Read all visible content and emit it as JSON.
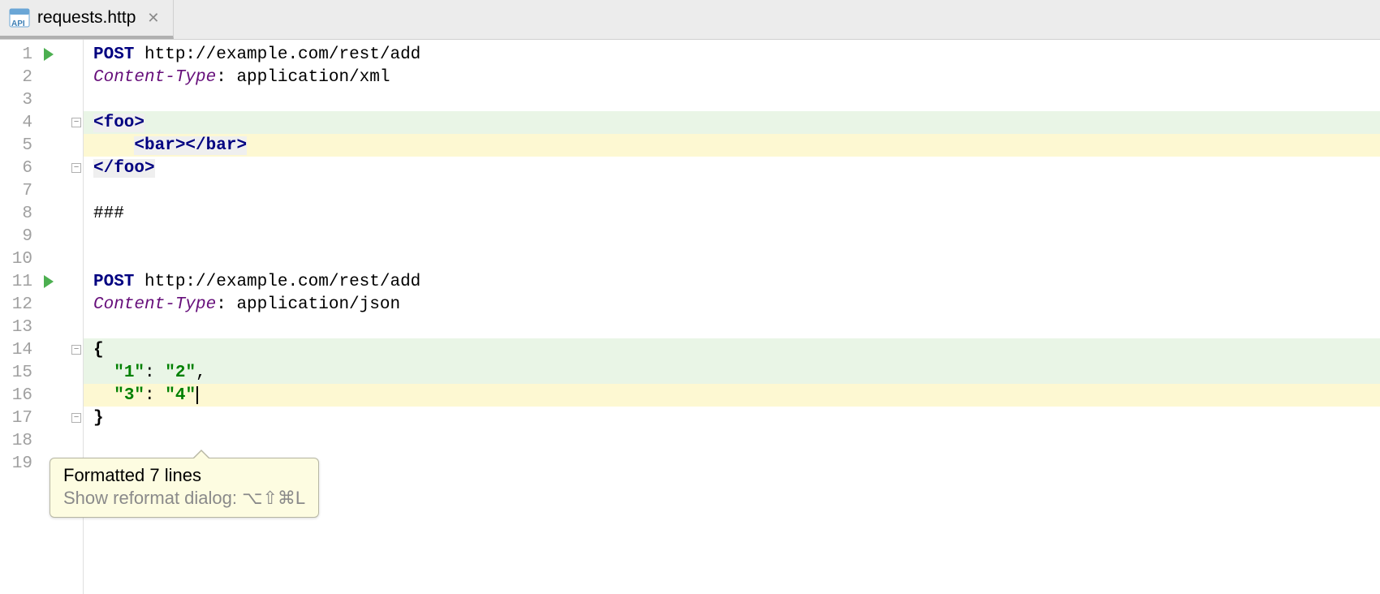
{
  "tab": {
    "filename": "requests.http",
    "icon_label": "API"
  },
  "gutter": {
    "line_count": 19,
    "run_markers": [
      1,
      11
    ],
    "fold_open": [
      4,
      14
    ],
    "fold_close": [
      6,
      17
    ]
  },
  "code": {
    "lines": [
      {
        "n": 1,
        "seg": [
          {
            "c": "kw",
            "t": "POST"
          },
          {
            "c": "txt",
            "t": " http://example.com/rest/add"
          }
        ]
      },
      {
        "n": 2,
        "seg": [
          {
            "c": "hdr",
            "t": "Content-Type"
          },
          {
            "c": "txt",
            "t": ": application/xml"
          }
        ]
      },
      {
        "n": 3,
        "seg": []
      },
      {
        "n": 4,
        "bg": "hl-green",
        "seg": [
          {
            "c": "tag",
            "t": "<foo>"
          }
        ]
      },
      {
        "n": 5,
        "bg": "hl-yellow",
        "indent": "    ",
        "seg": [
          {
            "c": "tag",
            "t": "<bar></bar>"
          }
        ]
      },
      {
        "n": 6,
        "seg": [
          {
            "c": "tag",
            "t": "</foo>"
          }
        ]
      },
      {
        "n": 7,
        "seg": []
      },
      {
        "n": 8,
        "seg": [
          {
            "c": "txt",
            "t": "###"
          }
        ]
      },
      {
        "n": 9,
        "seg": []
      },
      {
        "n": 10,
        "seg": []
      },
      {
        "n": 11,
        "seg": [
          {
            "c": "kw",
            "t": "POST"
          },
          {
            "c": "txt",
            "t": " http://example.com/rest/add"
          }
        ]
      },
      {
        "n": 12,
        "seg": [
          {
            "c": "hdr",
            "t": "Content-Type"
          },
          {
            "c": "txt",
            "t": ": application/json"
          }
        ]
      },
      {
        "n": 13,
        "seg": []
      },
      {
        "n": 14,
        "bg": "hl-green",
        "seg": [
          {
            "c": "curly",
            "t": "{"
          }
        ]
      },
      {
        "n": 15,
        "bg": "hl-green",
        "indent": "  ",
        "seg": [
          {
            "c": "str",
            "t": "\"1\""
          },
          {
            "c": "txt",
            "t": ": "
          },
          {
            "c": "str",
            "t": "\"2\""
          },
          {
            "c": "txt",
            "t": ","
          }
        ]
      },
      {
        "n": 16,
        "bg": "hl-yellow",
        "indent": "  ",
        "cursor": true,
        "seg": [
          {
            "c": "str",
            "t": "\"3\""
          },
          {
            "c": "txt",
            "t": ": "
          },
          {
            "c": "str",
            "t": "\"4\""
          }
        ]
      },
      {
        "n": 17,
        "seg": [
          {
            "c": "curly",
            "t": "}"
          }
        ]
      },
      {
        "n": 18,
        "seg": []
      },
      {
        "n": 19,
        "seg": []
      }
    ]
  },
  "tooltip": {
    "line1": "Formatted 7 lines",
    "line2": "Show reformat dialog: ⌥⇧⌘L"
  }
}
